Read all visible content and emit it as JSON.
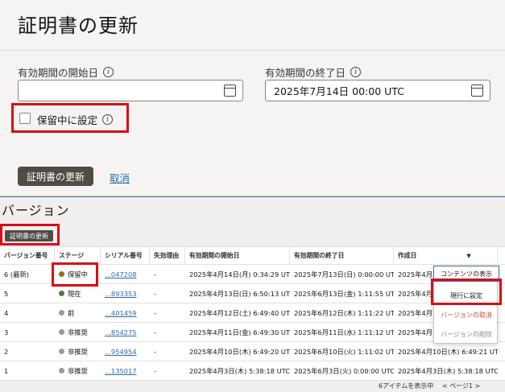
{
  "page": {
    "title": "証明書の更新"
  },
  "form": {
    "start_label": "有効期間の開始日",
    "start_value": "",
    "end_label": "有効期間の終了日",
    "end_value": "2025年7月14日 00:00 UTC",
    "hold_label": "保留中に設定",
    "info_glyph": "i",
    "submit_label": "証明書の更新",
    "cancel_label": "取消"
  },
  "versions": {
    "title": "バージョン",
    "update_button": "証明書の更新",
    "columns": [
      "バージョン番号",
      "ステージ",
      "シリアル番号",
      "失効理由",
      "有効期間の開始日",
      "有効期間の終了日",
      "作成日"
    ],
    "sort_glyph": "▼",
    "rows": [
      {
        "version": "6 (最新)",
        "stage": "保留中",
        "stage_color": "#a06a1a",
        "serial": "...047208",
        "reason": "-",
        "start": "2025年4月14日(月) 0:34:29 UTC",
        "end": "2025年7月13日(日) 0:00:00 UTC",
        "created": "2025年4月1"
      },
      {
        "version": "5",
        "stage": "現在",
        "stage_color": "#4f7d3a",
        "serial": "...893353",
        "reason": "-",
        "start": "2025年4月13日(日) 6:50:13 UTC",
        "end": "2025年6月13日(金) 1:11:55 UTC",
        "created": "2025年4月1"
      },
      {
        "version": "4",
        "stage": "前",
        "stage_color": "#9e9994",
        "serial": "...401459",
        "reason": "-",
        "start": "2025年4月12日(土) 6:49:40 UTC",
        "end": "2025年6月12日(木) 1:11:22 UTC",
        "created": "2025年4月1"
      },
      {
        "version": "3",
        "stage": "非推奨",
        "stage_color": "#9e9994",
        "serial": "...854275",
        "reason": "-",
        "start": "2025年4月11日(金) 6:49:30 UTC",
        "end": "2025年6月11日(水) 1:11:12 UTC",
        "created": "2025年4月1"
      },
      {
        "version": "2",
        "stage": "非推奨",
        "stage_color": "#9e9994",
        "serial": "...954954",
        "reason": "-",
        "start": "2025年4月10日(木) 6:49:20 UTC",
        "end": "2025年6月10日(火) 1:11:02 UTC",
        "created": "2025年4月10日(木) 6:49:21 UTC"
      },
      {
        "version": "1",
        "stage": "非推奨",
        "stage_color": "#9e9994",
        "serial": "...135017",
        "reason": "-",
        "start": "2025年4月3日(木) 5:38:18 UTC",
        "end": "2025年6月3日(火) 0:00:00 UTC",
        "created": "2025年4月3日(木) 5:38:18 UTC"
      }
    ],
    "kebab_glyph": "⋮"
  },
  "menu": {
    "show_contents": "コンテンツの表示",
    "set_current": "現行に設定",
    "cancel_version": "バージョンの取消",
    "delete_version": "バージョンの削除"
  },
  "footer": {
    "count": "6アイテムを表示中",
    "pager": "< ページ1 >"
  }
}
